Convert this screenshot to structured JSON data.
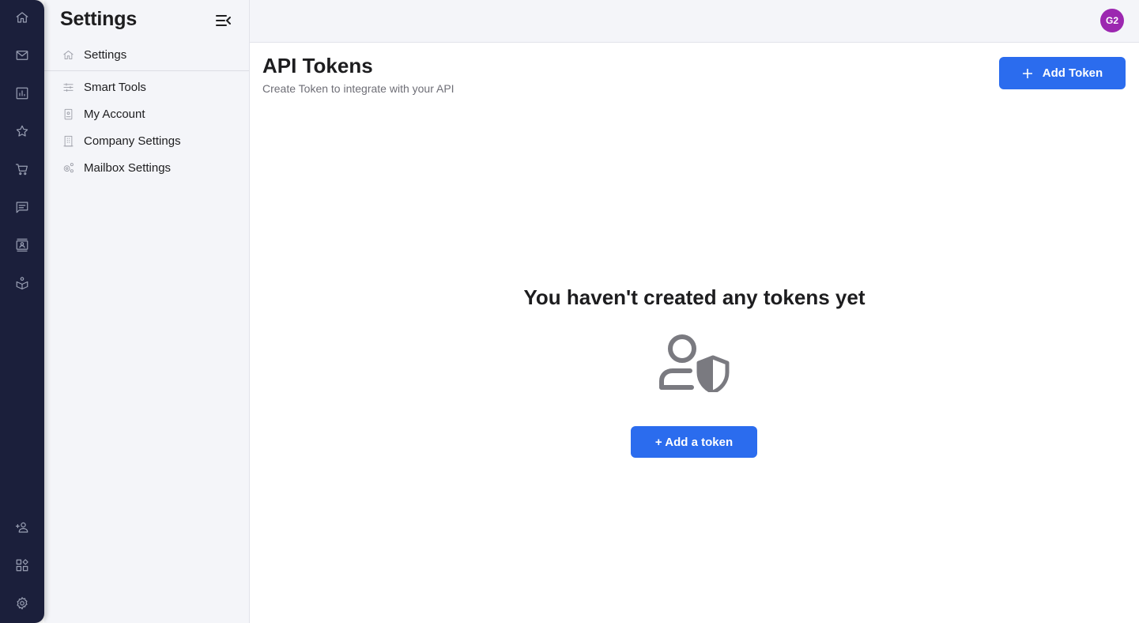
{
  "rail": {
    "top_icons": [
      "home-icon",
      "mail-icon",
      "analytics-icon",
      "star-icon",
      "cart-icon",
      "chat-icon",
      "contacts-icon",
      "learning-icon"
    ],
    "bottom_icons": [
      "add-user-icon",
      "apps-icon",
      "settings-gear-icon"
    ]
  },
  "sidebar": {
    "title": "Settings",
    "items": [
      {
        "label": "Settings",
        "icon": "home-icon"
      },
      {
        "label": "Smart Tools",
        "icon": "sliders-icon"
      },
      {
        "label": "My Account",
        "icon": "account-badge-icon"
      },
      {
        "label": "Company Settings",
        "icon": "building-icon"
      },
      {
        "label": "Mailbox Settings",
        "icon": "gears-icon"
      }
    ]
  },
  "topbar": {
    "avatar_initials": "G2",
    "avatar_color": "#9c27b0"
  },
  "main": {
    "title": "API Tokens",
    "subtitle": "Create Token to integrate with your API",
    "add_token_label": "Add Token",
    "empty_state": {
      "title": "You haven't created any tokens yet",
      "icon": "user-shield-icon",
      "button_label": "+ Add a token"
    }
  },
  "colors": {
    "accent": "#2b6cee",
    "rail_bg": "#1b1f3b",
    "sidebar_bg": "#f4f5f9"
  }
}
